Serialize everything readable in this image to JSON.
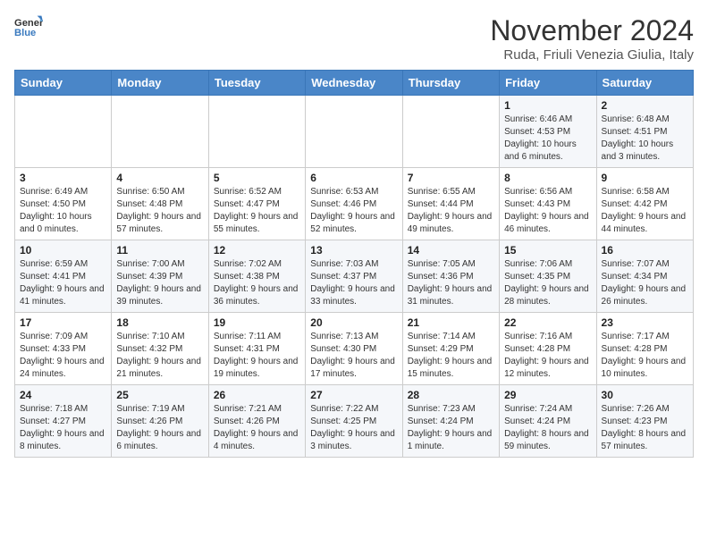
{
  "logo": {
    "text_general": "General",
    "text_blue": "Blue"
  },
  "header": {
    "title": "November 2024",
    "subtitle": "Ruda, Friuli Venezia Giulia, Italy"
  },
  "weekdays": [
    "Sunday",
    "Monday",
    "Tuesday",
    "Wednesday",
    "Thursday",
    "Friday",
    "Saturday"
  ],
  "weeks": [
    [
      {
        "day": "",
        "info": ""
      },
      {
        "day": "",
        "info": ""
      },
      {
        "day": "",
        "info": ""
      },
      {
        "day": "",
        "info": ""
      },
      {
        "day": "",
        "info": ""
      },
      {
        "day": "1",
        "info": "Sunrise: 6:46 AM\nSunset: 4:53 PM\nDaylight: 10 hours and 6 minutes."
      },
      {
        "day": "2",
        "info": "Sunrise: 6:48 AM\nSunset: 4:51 PM\nDaylight: 10 hours and 3 minutes."
      }
    ],
    [
      {
        "day": "3",
        "info": "Sunrise: 6:49 AM\nSunset: 4:50 PM\nDaylight: 10 hours and 0 minutes."
      },
      {
        "day": "4",
        "info": "Sunrise: 6:50 AM\nSunset: 4:48 PM\nDaylight: 9 hours and 57 minutes."
      },
      {
        "day": "5",
        "info": "Sunrise: 6:52 AM\nSunset: 4:47 PM\nDaylight: 9 hours and 55 minutes."
      },
      {
        "day": "6",
        "info": "Sunrise: 6:53 AM\nSunset: 4:46 PM\nDaylight: 9 hours and 52 minutes."
      },
      {
        "day": "7",
        "info": "Sunrise: 6:55 AM\nSunset: 4:44 PM\nDaylight: 9 hours and 49 minutes."
      },
      {
        "day": "8",
        "info": "Sunrise: 6:56 AM\nSunset: 4:43 PM\nDaylight: 9 hours and 46 minutes."
      },
      {
        "day": "9",
        "info": "Sunrise: 6:58 AM\nSunset: 4:42 PM\nDaylight: 9 hours and 44 minutes."
      }
    ],
    [
      {
        "day": "10",
        "info": "Sunrise: 6:59 AM\nSunset: 4:41 PM\nDaylight: 9 hours and 41 minutes."
      },
      {
        "day": "11",
        "info": "Sunrise: 7:00 AM\nSunset: 4:39 PM\nDaylight: 9 hours and 39 minutes."
      },
      {
        "day": "12",
        "info": "Sunrise: 7:02 AM\nSunset: 4:38 PM\nDaylight: 9 hours and 36 minutes."
      },
      {
        "day": "13",
        "info": "Sunrise: 7:03 AM\nSunset: 4:37 PM\nDaylight: 9 hours and 33 minutes."
      },
      {
        "day": "14",
        "info": "Sunrise: 7:05 AM\nSunset: 4:36 PM\nDaylight: 9 hours and 31 minutes."
      },
      {
        "day": "15",
        "info": "Sunrise: 7:06 AM\nSunset: 4:35 PM\nDaylight: 9 hours and 28 minutes."
      },
      {
        "day": "16",
        "info": "Sunrise: 7:07 AM\nSunset: 4:34 PM\nDaylight: 9 hours and 26 minutes."
      }
    ],
    [
      {
        "day": "17",
        "info": "Sunrise: 7:09 AM\nSunset: 4:33 PM\nDaylight: 9 hours and 24 minutes."
      },
      {
        "day": "18",
        "info": "Sunrise: 7:10 AM\nSunset: 4:32 PM\nDaylight: 9 hours and 21 minutes."
      },
      {
        "day": "19",
        "info": "Sunrise: 7:11 AM\nSunset: 4:31 PM\nDaylight: 9 hours and 19 minutes."
      },
      {
        "day": "20",
        "info": "Sunrise: 7:13 AM\nSunset: 4:30 PM\nDaylight: 9 hours and 17 minutes."
      },
      {
        "day": "21",
        "info": "Sunrise: 7:14 AM\nSunset: 4:29 PM\nDaylight: 9 hours and 15 minutes."
      },
      {
        "day": "22",
        "info": "Sunrise: 7:16 AM\nSunset: 4:28 PM\nDaylight: 9 hours and 12 minutes."
      },
      {
        "day": "23",
        "info": "Sunrise: 7:17 AM\nSunset: 4:28 PM\nDaylight: 9 hours and 10 minutes."
      }
    ],
    [
      {
        "day": "24",
        "info": "Sunrise: 7:18 AM\nSunset: 4:27 PM\nDaylight: 9 hours and 8 minutes."
      },
      {
        "day": "25",
        "info": "Sunrise: 7:19 AM\nSunset: 4:26 PM\nDaylight: 9 hours and 6 minutes."
      },
      {
        "day": "26",
        "info": "Sunrise: 7:21 AM\nSunset: 4:26 PM\nDaylight: 9 hours and 4 minutes."
      },
      {
        "day": "27",
        "info": "Sunrise: 7:22 AM\nSunset: 4:25 PM\nDaylight: 9 hours and 3 minutes."
      },
      {
        "day": "28",
        "info": "Sunrise: 7:23 AM\nSunset: 4:24 PM\nDaylight: 9 hours and 1 minute."
      },
      {
        "day": "29",
        "info": "Sunrise: 7:24 AM\nSunset: 4:24 PM\nDaylight: 8 hours and 59 minutes."
      },
      {
        "day": "30",
        "info": "Sunrise: 7:26 AM\nSunset: 4:23 PM\nDaylight: 8 hours and 57 minutes."
      }
    ]
  ]
}
